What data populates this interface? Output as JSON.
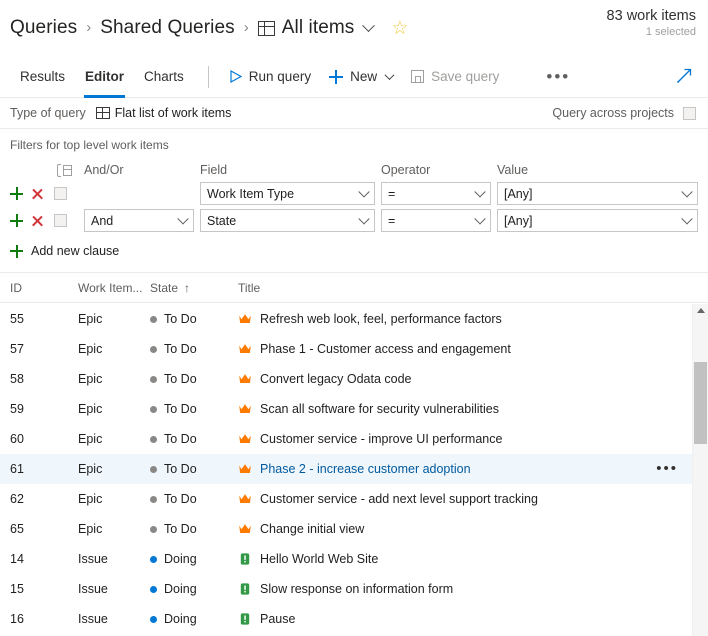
{
  "header": {
    "breadcrumb": [
      {
        "label": "Queries",
        "icon": null
      },
      {
        "label": "Shared Queries",
        "icon": null
      },
      {
        "label": "All items",
        "icon": "grid-icon"
      }
    ],
    "separator": "›",
    "dropdown_icon": "chevron-down-icon",
    "favorite_icon": "star-icon",
    "favorite_glyph": "☆",
    "work_item_count": "83 work items",
    "selection_count": "1 selected"
  },
  "commandbar": {
    "tabs": [
      {
        "label": "Results",
        "active": false
      },
      {
        "label": "Editor",
        "active": true
      },
      {
        "label": "Charts",
        "active": false
      }
    ],
    "run_query": "Run query",
    "new": "New",
    "save_query": "Save query",
    "overflow_glyph": "•••",
    "expand_icon": "expand-arrow-icon"
  },
  "querytype": {
    "label": "Type of query",
    "value": "Flat list of work items",
    "across_projects_label": "Query across projects",
    "across_projects_checked": false
  },
  "filters": {
    "title": "Filters for top level work items",
    "columns": {
      "group": "",
      "andor": "And/Or",
      "field": "Field",
      "operator": "Operator",
      "value": "Value"
    },
    "rows": [
      {
        "andor": "",
        "field": "Work Item Type",
        "operator": "=",
        "value": "[Any]",
        "checked": false
      },
      {
        "andor": "And",
        "field": "State",
        "operator": "=",
        "value": "[Any]",
        "checked": false
      }
    ],
    "add_clause": "Add new clause"
  },
  "grid": {
    "columns": [
      {
        "label": "ID",
        "sort": null
      },
      {
        "label": "Work Item...",
        "sort": null
      },
      {
        "label": "State",
        "sort": "asc"
      },
      {
        "label": "Title",
        "sort": null
      }
    ],
    "sort_glyph": "↑",
    "row_overflow_glyph": "•••",
    "rows": [
      {
        "id": "55",
        "type": "Epic",
        "state": "To Do",
        "state_color": "#8a8886",
        "title": "Refresh web look, feel, performance factors",
        "icon": "epic-crown-icon",
        "selected": false
      },
      {
        "id": "57",
        "type": "Epic",
        "state": "To Do",
        "state_color": "#8a8886",
        "title": "Phase 1 - Customer access and engagement",
        "icon": "epic-crown-icon",
        "selected": false
      },
      {
        "id": "58",
        "type": "Epic",
        "state": "To Do",
        "state_color": "#8a8886",
        "title": "Convert legacy Odata code",
        "icon": "epic-crown-icon",
        "selected": false
      },
      {
        "id": "59",
        "type": "Epic",
        "state": "To Do",
        "state_color": "#8a8886",
        "title": "Scan all software for security vulnerabilities",
        "icon": "epic-crown-icon",
        "selected": false
      },
      {
        "id": "60",
        "type": "Epic",
        "state": "To Do",
        "state_color": "#8a8886",
        "title": "Customer service - improve UI performance",
        "icon": "epic-crown-icon",
        "selected": false
      },
      {
        "id": "61",
        "type": "Epic",
        "state": "To Do",
        "state_color": "#8a8886",
        "title": "Phase 2 - increase customer adoption",
        "icon": "epic-crown-icon",
        "selected": true
      },
      {
        "id": "62",
        "type": "Epic",
        "state": "To Do",
        "state_color": "#8a8886",
        "title": "Customer service - add next level support tracking",
        "icon": "epic-crown-icon",
        "selected": false
      },
      {
        "id": "65",
        "type": "Epic",
        "state": "To Do",
        "state_color": "#8a8886",
        "title": "Change initial view",
        "icon": "epic-crown-icon",
        "selected": false
      },
      {
        "id": "14",
        "type": "Issue",
        "state": "Doing",
        "state_color": "#0078d4",
        "title": "Hello World Web Site",
        "icon": "issue-icon",
        "selected": false
      },
      {
        "id": "15",
        "type": "Issue",
        "state": "Doing",
        "state_color": "#0078d4",
        "title": "Slow response on information form",
        "icon": "issue-icon",
        "selected": false
      },
      {
        "id": "16",
        "type": "Issue",
        "state": "Doing",
        "state_color": "#0078d4",
        "title": "Pause",
        "icon": "issue-icon",
        "selected": false
      }
    ]
  },
  "colors": {
    "accent": "#0078d4",
    "epic_orange": "#ff7b00",
    "issue_green": "#339947",
    "selected_row": "#eff6fc",
    "star_gold": "#f2c94c",
    "add_green": "#107c10",
    "remove_red": "#d13438"
  }
}
